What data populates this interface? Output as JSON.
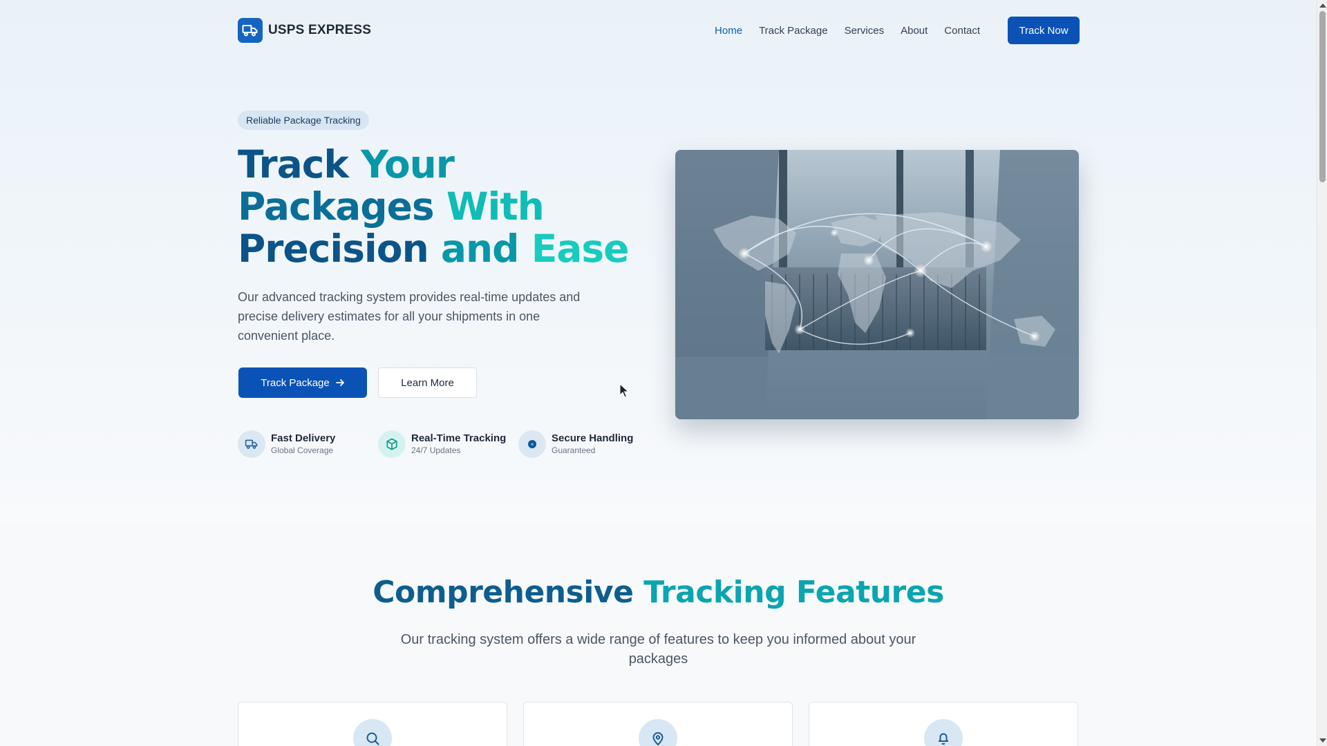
{
  "brand": {
    "name": "USPS EXPRESS",
    "logo_icon": "truck-icon",
    "color": "#1565c0"
  },
  "nav": {
    "links": [
      {
        "label": "Home",
        "active": true
      },
      {
        "label": "Track Package",
        "active": false
      },
      {
        "label": "Services",
        "active": false
      },
      {
        "label": "About",
        "active": false
      },
      {
        "label": "Contact",
        "active": false
      }
    ],
    "cta_label": "Track Now"
  },
  "hero": {
    "badge": "Reliable Package Tracking",
    "title_words": [
      "Track",
      "Your",
      "Packages",
      "With",
      "Precision",
      "and",
      "Ease"
    ],
    "description": "Our advanced tracking system provides real-time updates and precise delivery estimates for all your shipments in one convenient place.",
    "primary_button": "Track Package",
    "secondary_button": "Learn More",
    "stats": [
      {
        "title": "Fast Delivery",
        "subtitle": "Global Coverage",
        "icon": "truck-icon"
      },
      {
        "title": "Real-Time Tracking",
        "subtitle": "24/7 Updates",
        "icon": "package-icon"
      },
      {
        "title": "Secure Handling",
        "subtitle": "Guaranteed",
        "icon": "shield-icon"
      }
    ]
  },
  "features": {
    "title_part1": "Comprehensive",
    "title_part2": "Tracking Features",
    "description": "Our tracking system offers a wide range of features to keep you informed about your packages",
    "card_icons": [
      "search-icon",
      "map-pin-icon",
      "bell-icon"
    ]
  },
  "colors": {
    "primary_button": "#0b52b6",
    "title_dark": "#0c5488",
    "title_teal": "#17cbbf",
    "badge_bg": "#d6e6f2"
  }
}
